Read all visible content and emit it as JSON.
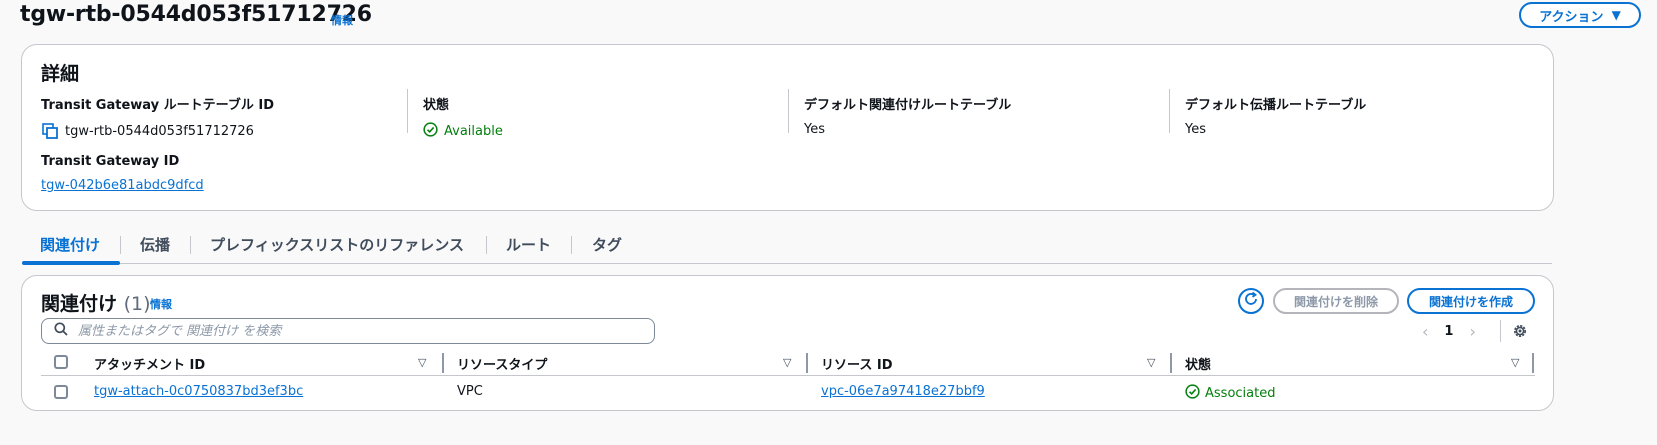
{
  "page": {
    "title": "tgw-rtb-0544d053f51712726",
    "info_label": "情報",
    "action_label": "アクション"
  },
  "details": {
    "heading": "詳細",
    "route_table_id": {
      "label": "Transit Gateway ルートテーブル ID",
      "value": "tgw-rtb-0544d053f51712726"
    },
    "state": {
      "label": "状態",
      "value": "Available"
    },
    "default_association": {
      "label": "デフォルト関連付けルートテーブル",
      "value": "Yes"
    },
    "default_propagation": {
      "label": "デフォルト伝播ルートテーブル",
      "value": "Yes"
    },
    "transit_gateway_id": {
      "label": "Transit Gateway ID",
      "value": "tgw-042b6e81abdc9dfcd"
    }
  },
  "tabs": [
    {
      "label": "関連付け",
      "active": true
    },
    {
      "label": "伝播",
      "active": false
    },
    {
      "label": "プレフィックスリストのリファレンス",
      "active": false
    },
    {
      "label": "ルート",
      "active": false
    },
    {
      "label": "タグ",
      "active": false
    }
  ],
  "associations": {
    "heading": "関連付け",
    "count": "(1)",
    "info_label": "情報",
    "delete_label": "関連付けを削除",
    "create_label": "関連付けを作成",
    "search_placeholder": "属性またはタグで 関連付け を検索",
    "page_number": "1",
    "columns": [
      "アタッチメント ID",
      "リソースタイプ",
      "リソース ID",
      "状態"
    ],
    "rows": [
      {
        "attachment_id": "tgw-attach-0c0750837bd3ef3bc",
        "resource_type": "VPC",
        "resource_id": "vpc-06e7a97418e27bbf9",
        "state": "Associated"
      }
    ]
  },
  "colors": {
    "accent": "#0972d3",
    "success": "#037f0c",
    "border": "#c6c6cd"
  },
  "icons": [
    "copy-icon",
    "status-check-icon",
    "refresh-icon",
    "search-icon",
    "chevron-left-icon",
    "chevron-right-icon",
    "settings-gear-icon",
    "sort-icon",
    "caret-down-icon"
  ]
}
